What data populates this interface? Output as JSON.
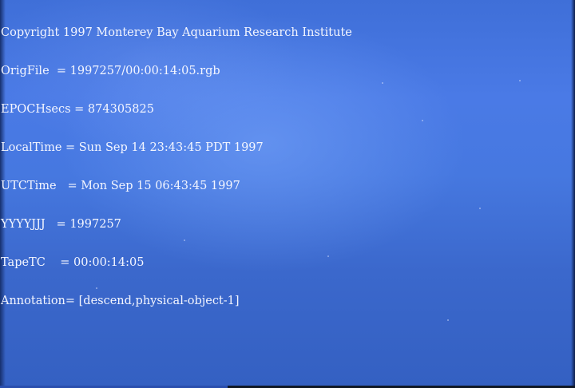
{
  "overlay": {
    "lines": [
      "Copyright 1997 Monterey Bay Aquarium Research Institute",
      "OrigFile  = 1997257/00:00:14:05.rgb",
      "EPOCHsecs = 874305825",
      "LocalTime = Sun Sep 14 23:43:45 PDT 1997",
      "UTCTime   = Mon Sep 15 06:43:45 1997",
      "YYYYJJJ   = 1997257",
      "TapeTC    = 00:00:14:05",
      "Annotation= [descend,physical-object-1]"
    ]
  },
  "colors": {
    "water_light": "#78a5fa",
    "water_mid": "#4a7ae6",
    "water_deep": "#3460c2",
    "overlay_text": "#f4f6ff"
  }
}
